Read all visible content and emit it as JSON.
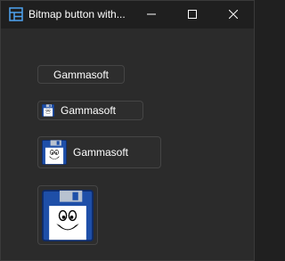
{
  "window": {
    "title": "Bitmap button with...",
    "icons": {
      "app": "window-layout-icon",
      "minimize": "minimize-icon",
      "maximize": "maximize-icon",
      "close": "close-icon",
      "bitmap": "floppy-disk-face-icon"
    }
  },
  "buttons": {
    "text_only": {
      "label": "Gammasoft"
    },
    "small_bitmap": {
      "label": "Gammasoft"
    },
    "medium_bitmap": {
      "label": "Gammasoft"
    },
    "large_bitmap": {
      "label": ""
    }
  },
  "colors": {
    "disk_blue": "#1e4fa8",
    "background": "#2b2b2b",
    "titlebar": "#1f1f1f"
  }
}
